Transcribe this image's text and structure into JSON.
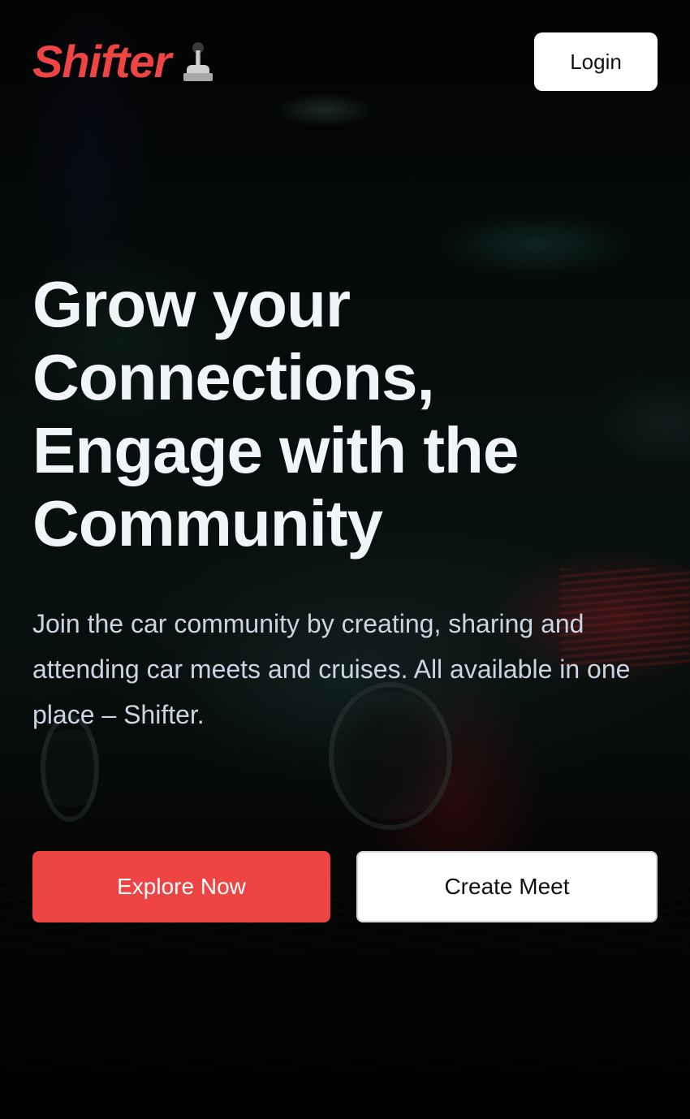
{
  "header": {
    "logo_text": "Shifter",
    "logo_icon": "gear-shifter-icon",
    "login_label": "Login"
  },
  "hero": {
    "title": "Grow your Connections, Engage with the Community",
    "subtitle": "Join the car community by creating, sharing and attending car meets and cruises. All available in one place – Shifter."
  },
  "actions": {
    "explore_label": "Explore Now",
    "create_label": "Create Meet"
  },
  "colors": {
    "brand": "#ef4444",
    "title_text": "#f1f5f9",
    "subtitle_text": "#cbd5e1",
    "button_light": "#ffffff"
  }
}
